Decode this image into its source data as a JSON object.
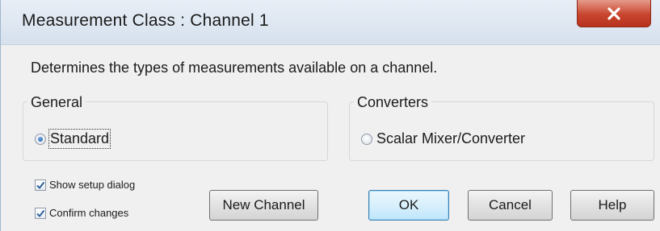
{
  "window": {
    "title": "Measurement Class : Channel 1",
    "close_icon": "close-icon"
  },
  "description": "Determines the types of measurements available on a channel.",
  "groups": {
    "general": {
      "legend": "General",
      "option_label": "Standard",
      "selected": true
    },
    "converters": {
      "legend": "Converters",
      "option_label": "Scalar Mixer/Converter",
      "selected": false
    }
  },
  "checkboxes": {
    "show_setup": {
      "label": "Show setup dialog",
      "checked": true
    },
    "confirm_changes": {
      "label": "Confirm changes",
      "checked": true
    }
  },
  "buttons": {
    "new_channel": "New Channel",
    "ok": "OK",
    "cancel": "Cancel",
    "help": "Help"
  },
  "colors": {
    "close_button": "#c8452e",
    "default_button_border": "#3c7fb1",
    "radio_dot": "#1f5fa8"
  }
}
